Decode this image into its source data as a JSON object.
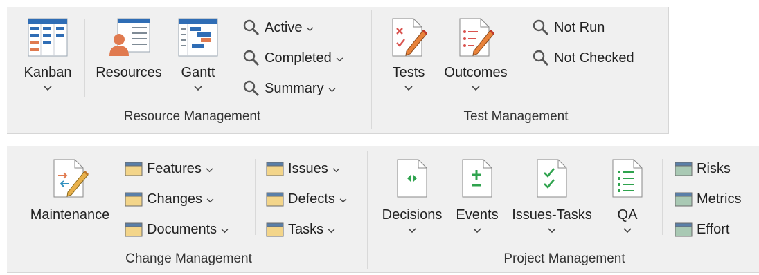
{
  "resource_management": {
    "group_label": "Resource Management",
    "kanban_label": "Kanban",
    "resources_label": "Resources",
    "gantt_label": "Gantt",
    "active_label": "Active",
    "completed_label": "Completed",
    "summary_label": "Summary"
  },
  "test_management": {
    "group_label": "Test Management",
    "tests_label": "Tests",
    "outcomes_label": "Outcomes",
    "not_run_label": "Not Run",
    "not_checked_label": "Not Checked"
  },
  "change_management": {
    "group_label": "Change Management",
    "maintenance_label": "Maintenance",
    "features_label": "Features",
    "changes_label": "Changes",
    "documents_label": "Documents",
    "issues_label": "Issues",
    "defects_label": "Defects",
    "tasks_label": "Tasks"
  },
  "project_management": {
    "group_label": "Project Management",
    "decisions_label": "Decisions",
    "events_label": "Events",
    "issues_tasks_label": "Issues-Tasks",
    "qa_label": "QA",
    "risks_label": "Risks",
    "metrics_label": "Metrics",
    "effort_label": "Effort"
  },
  "colors": {
    "ribbon_bg": "#f0f0f0",
    "kanban_blue": "#2f6db5",
    "accent_orange": "#e07a4f",
    "folder_yellow": "#f3d58a",
    "folder_green": "#a9c9b4",
    "doc_green": "#2fa34e",
    "test_red": "#d9534f"
  }
}
